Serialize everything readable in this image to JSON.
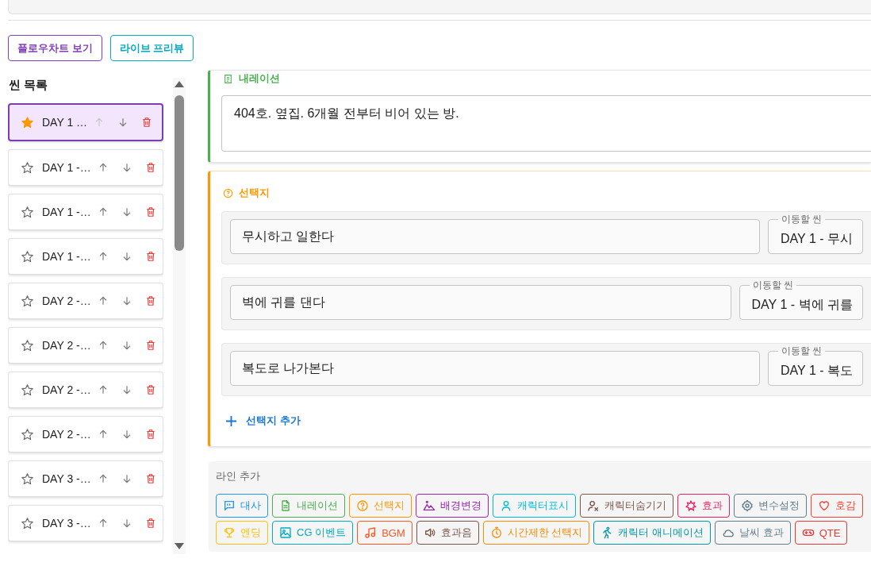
{
  "view_buttons": [
    {
      "label": "플로우차트 보기",
      "color": "#7e3fb8"
    },
    {
      "label": "라이브 프리뷰",
      "color": "#00acc1"
    }
  ],
  "scene_list": {
    "title": "씬 목록",
    "scenes": [
      {
        "title": "DAY 1 …",
        "selected": true,
        "starred": true,
        "move_up_disabled": true
      },
      {
        "title": "DAY 1 -…",
        "selected": false,
        "starred": false,
        "move_up_disabled": false
      },
      {
        "title": "DAY 1 -…",
        "selected": false,
        "starred": false,
        "move_up_disabled": false
      },
      {
        "title": "DAY 1 -…",
        "selected": false,
        "starred": false,
        "move_up_disabled": false
      },
      {
        "title": "DAY 2 -…",
        "selected": false,
        "starred": false,
        "move_up_disabled": false
      },
      {
        "title": "DAY 2 -…",
        "selected": false,
        "starred": false,
        "move_up_disabled": false
      },
      {
        "title": "DAY 2 -…",
        "selected": false,
        "starred": false,
        "move_up_disabled": false
      },
      {
        "title": "DAY 2 -…",
        "selected": false,
        "starred": false,
        "move_up_disabled": false
      },
      {
        "title": "DAY 3 -…",
        "selected": false,
        "starred": false,
        "move_up_disabled": false
      },
      {
        "title": "DAY 3 -…",
        "selected": false,
        "starred": false,
        "move_up_disabled": false
      }
    ]
  },
  "narration": {
    "title": "내레이션",
    "text": "404호. 옆집. 6개월 전부터 비어 있는 방."
  },
  "choices": {
    "title": "선택지",
    "items": [
      {
        "text": "무시하고 일한다",
        "target_label": "이동할 씬",
        "target": "DAY 1 - 무시"
      },
      {
        "text": "벽에 귀를 댄다",
        "target_label": "이동할 씬",
        "target": "DAY 1 - 벽에 귀를"
      },
      {
        "text": "복도로 나가본다",
        "target_label": "이동할 씬",
        "target": "DAY 1 - 복도"
      }
    ],
    "add_button": "선택지 추가"
  },
  "add_line": {
    "label": "라인 추가",
    "button_rows": [
      [
        {
          "label": "대사",
          "kind": "dialogue",
          "color": "#2196f3"
        },
        {
          "label": "내레이션",
          "kind": "narration",
          "color": "#4caf50"
        },
        {
          "label": "선택지",
          "kind": "choice",
          "color": "#ff9800"
        },
        {
          "label": "배경변경",
          "kind": "background",
          "color": "#9c27b0"
        },
        {
          "label": "캐릭터표시",
          "kind": "show",
          "color": "#00bcd4"
        },
        {
          "label": "캐릭터숨기기",
          "kind": "hide",
          "color": "#795548"
        },
        {
          "label": "효과",
          "kind": "effect",
          "color": "#e91e63"
        },
        {
          "label": "변수설정",
          "kind": "variable",
          "color": "#607d8b"
        },
        {
          "label": "호감",
          "kind": "affection",
          "color": "#f44336"
        }
      ],
      [
        {
          "label": "엔딩",
          "kind": "ending",
          "color": "#ffc107"
        },
        {
          "label": "CG 이벤트",
          "kind": "cg",
          "color": "#00acc1"
        },
        {
          "label": "BGM",
          "kind": "bgm",
          "color": "#ff5722"
        },
        {
          "label": "효과음",
          "kind": "sfx",
          "color": "#795548"
        },
        {
          "label": "시간제한 선택지",
          "kind": "timed",
          "color": "#fb8c00"
        },
        {
          "label": "캐릭터 애니메이션",
          "kind": "animation",
          "color": "#0097a7"
        },
        {
          "label": "날씨 효과",
          "kind": "weather",
          "color": "#607d8b"
        },
        {
          "label": "QTE",
          "kind": "qte",
          "color": "#e53935"
        }
      ]
    ]
  }
}
